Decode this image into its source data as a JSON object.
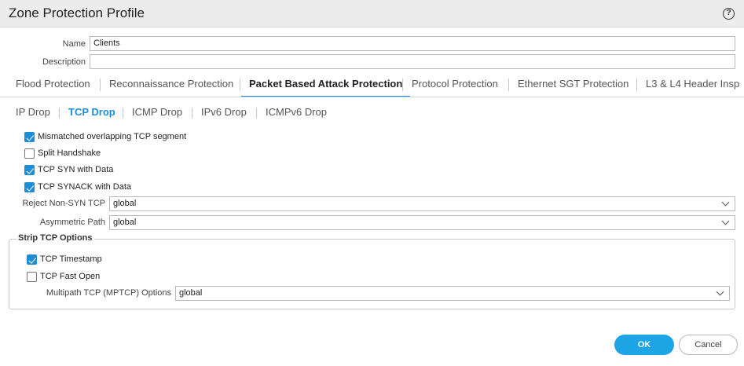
{
  "dialog": {
    "title": "Zone Protection Profile",
    "help_icon": "?"
  },
  "form": {
    "name_label": "Name",
    "name_value": "Clients",
    "description_label": "Description",
    "description_value": ""
  },
  "tabs": [
    {
      "label": "Flood Protection",
      "active": false
    },
    {
      "label": "Reconnaissance Protection",
      "active": false
    },
    {
      "label": "Packet Based Attack Protection",
      "active": true
    },
    {
      "label": "Protocol Protection",
      "active": false
    },
    {
      "label": "Ethernet SGT Protection",
      "active": false
    },
    {
      "label": "L3 & L4 Header Insp",
      "active": false
    }
  ],
  "subtabs": [
    {
      "label": "IP Drop",
      "active": false
    },
    {
      "label": "TCP Drop",
      "active": true
    },
    {
      "label": "ICMP Drop",
      "active": false
    },
    {
      "label": "IPv6 Drop",
      "active": false
    },
    {
      "label": "ICMPv6 Drop",
      "active": false
    }
  ],
  "tcp_drop": {
    "options": [
      {
        "label": "Mismatched overlapping TCP segment",
        "checked": true
      },
      {
        "label": "Split Handshake",
        "checked": false
      },
      {
        "label": "TCP SYN with Data",
        "checked": true
      },
      {
        "label": "TCP SYNACK with Data",
        "checked": true
      }
    ],
    "reject_non_syn_label": "Reject Non-SYN TCP",
    "reject_non_syn_value": "global",
    "asymmetric_path_label": "Asymmetric Path",
    "asymmetric_path_value": "global"
  },
  "strip_tcp_options": {
    "legend": "Strip TCP Options",
    "options": [
      {
        "label": "TCP Timestamp",
        "checked": true
      },
      {
        "label": "TCP Fast Open",
        "checked": false
      }
    ],
    "mptcp_label": "Multipath TCP (MPTCP) Options",
    "mptcp_value": "global"
  },
  "buttons": {
    "ok": "OK",
    "cancel": "Cancel"
  },
  "colors": {
    "accent": "#1d8dd5",
    "ok_button": "#1ea5e6",
    "titlebar": "#ececec"
  }
}
